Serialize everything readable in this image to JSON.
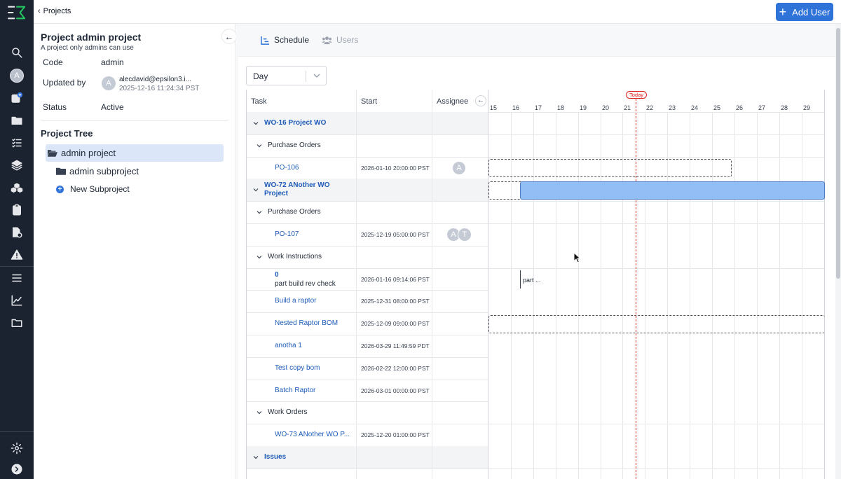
{
  "nav": {
    "brand_icon": "epsilon3-logo",
    "avatar_initial": "A",
    "icons": [
      "search-icon",
      "avatar",
      "new-item-icon",
      "folder-icon",
      "checklist-icon",
      "layers-icon",
      "parts-icon",
      "clipboard-icon",
      "file-clock-icon",
      "warning-icon",
      "list-icon",
      "chart-icon",
      "folder-outline-icon"
    ],
    "bottom_icons": [
      "gear-icon",
      "chevron-right-circle-icon"
    ]
  },
  "topbar": {
    "breadcrumb": "Projects",
    "add_user_label": "Add User",
    "accent": "#2f73d9"
  },
  "project": {
    "title": "Project admin project",
    "subtitle": "A project only admins can use",
    "code_label": "Code",
    "code_value": "admin",
    "updated_label": "Updated by",
    "updated_user": "alecdavid@epsilon3.i...",
    "updated_initial": "A",
    "updated_date": "2025-12-16 11:24:34 PST",
    "status_label": "Status",
    "status_value": "Active"
  },
  "tree": {
    "title": "Project Tree",
    "selected": "admin project",
    "child": "admin subproject",
    "new_label": "New Subproject"
  },
  "tabs": {
    "schedule": "Schedule",
    "users": "Users"
  },
  "view": {
    "selected": "Day"
  },
  "schedule": {
    "headers": {
      "task": "Task",
      "start": "Start",
      "assignee": "Assignee"
    },
    "today_label": "Today",
    "dates": [
      "15",
      "16",
      "17",
      "18",
      "19",
      "20",
      "21",
      "22",
      "23",
      "24",
      "25",
      "26",
      "27",
      "28",
      "29"
    ],
    "rows": [
      {
        "kind": "group",
        "task": "WO-16 Project WO",
        "start": "",
        "assignees": []
      },
      {
        "kind": "sub",
        "task": "Purchase Orders",
        "start": "",
        "assignees": []
      },
      {
        "kind": "item",
        "task": "PO-106",
        "start": "2026-01-10 20:00:00 PST",
        "assignees": [
          "A"
        ]
      },
      {
        "kind": "group",
        "task": "WO-72 ANother WO Project",
        "start": "",
        "assignees": []
      },
      {
        "kind": "sub",
        "task": "Purchase Orders",
        "start": "",
        "assignees": []
      },
      {
        "kind": "item",
        "task": "PO-107",
        "start": "2025-12-19 05:00:00 PST",
        "assignees": [
          "A",
          "T"
        ]
      },
      {
        "kind": "sub",
        "task": "Work Instructions",
        "start": "",
        "assignees": []
      },
      {
        "kind": "item2",
        "task": "0",
        "task_sub": "part build rev check",
        "start": "2026-01-16 09:14:06 PST",
        "assignees": []
      },
      {
        "kind": "item",
        "task": "Build a raptor",
        "start": "2025-12-31 08:00:00 PST",
        "assignees": []
      },
      {
        "kind": "item",
        "task": "Nested Raptor BOM",
        "start": "2025-12-09 09:00:00 PST",
        "assignees": []
      },
      {
        "kind": "item",
        "task": "anotha 1",
        "start": "2026-03-29 11:49:59 PDT",
        "assignees": []
      },
      {
        "kind": "item",
        "task": "Test copy bom",
        "start": "2026-02-22 12:00:00 PST",
        "assignees": []
      },
      {
        "kind": "item",
        "task": "Batch Raptor",
        "start": "2026-03-01 00:00:00 PST",
        "assignees": []
      },
      {
        "kind": "sub",
        "task": "Work Orders",
        "start": "",
        "assignees": []
      },
      {
        "kind": "item",
        "task": "WO-73 ANother WO P...",
        "start": "2025-12-20 01:00:00 PST",
        "assignees": []
      },
      {
        "kind": "group",
        "task": "Issues",
        "start": "",
        "assignees": []
      }
    ],
    "milestone_label": "part ...",
    "bar_color": "#93bdf5",
    "today_color": "#dc2626"
  }
}
